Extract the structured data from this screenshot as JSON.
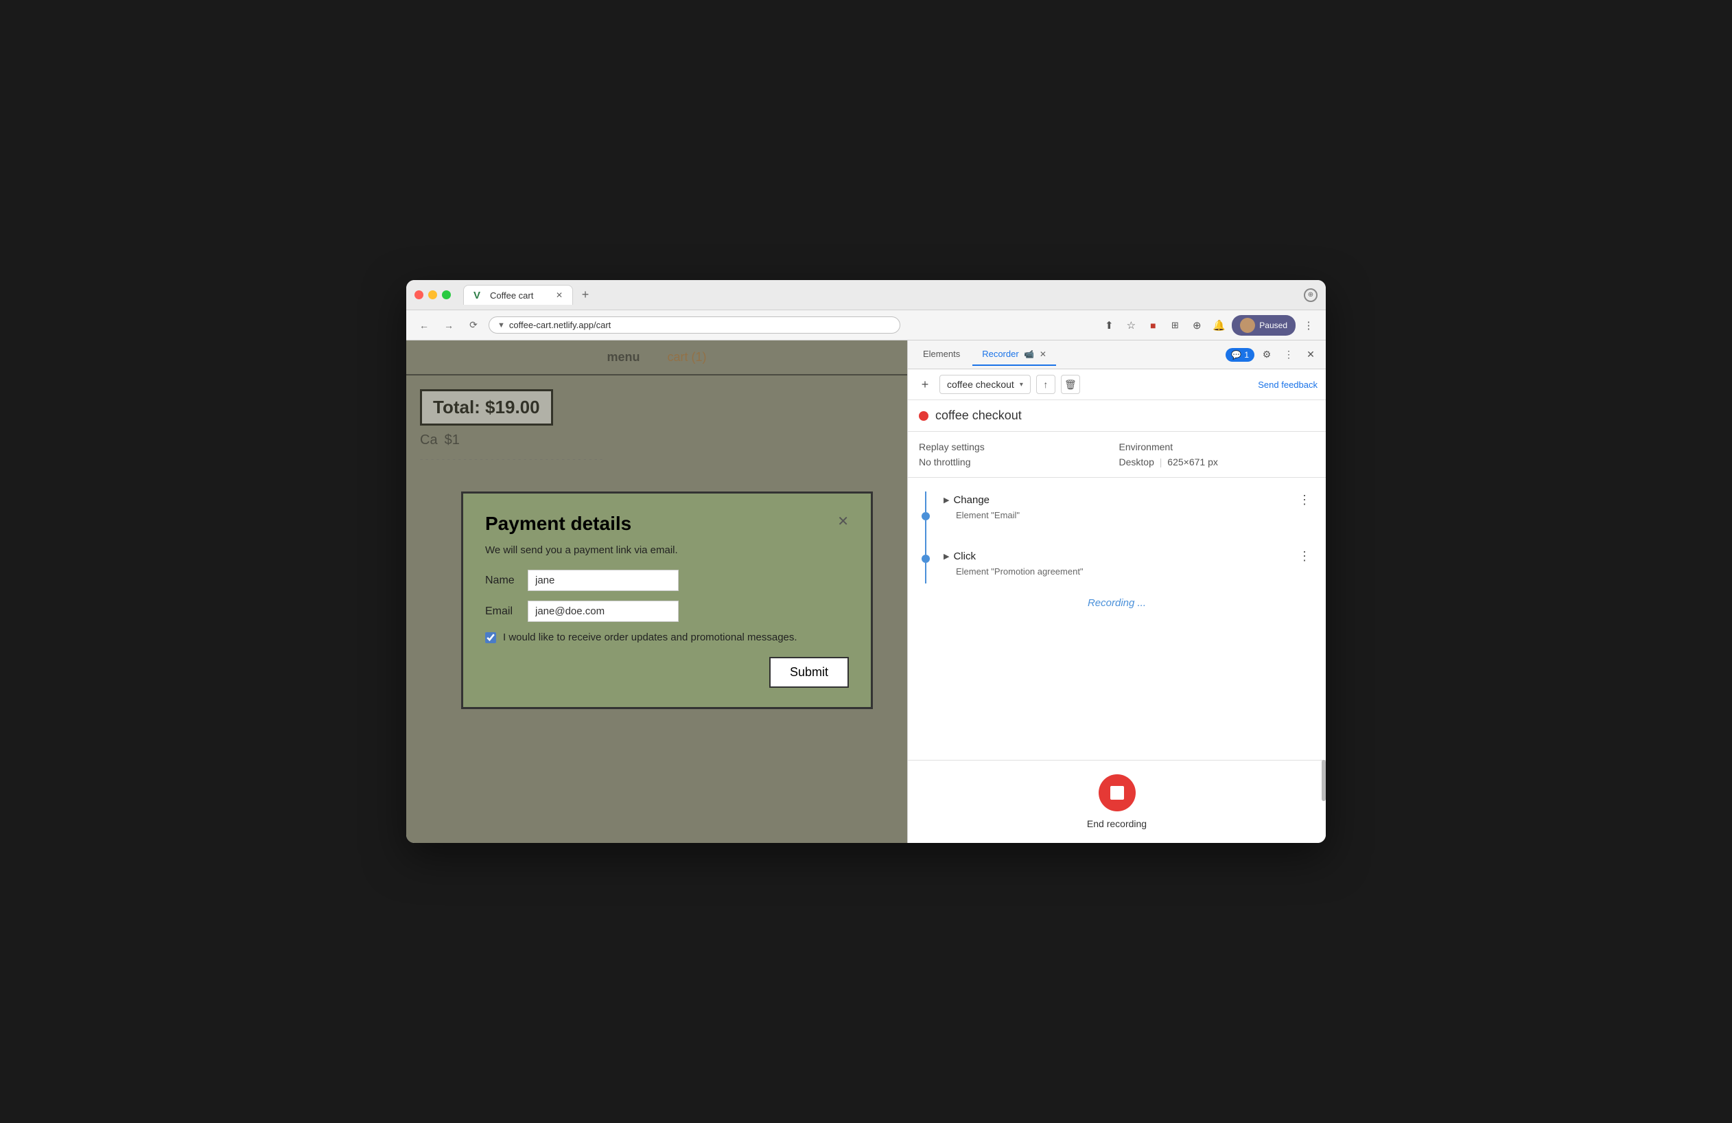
{
  "window": {
    "title": "Coffee cart"
  },
  "browser": {
    "tab_title": "Coffee cart",
    "tab_favicon": "V",
    "url": "coffee-cart.netlify.app/cart",
    "paused_label": "Paused"
  },
  "website": {
    "nav_menu": "menu",
    "nav_cart": "cart (1)",
    "total_label": "Total: $19.00",
    "cart_item_label": "Ca",
    "cart_item_price": "$1",
    "dashes": "- - - - - - - - - - - - - - - - - - -"
  },
  "modal": {
    "title": "Payment details",
    "subtitle": "We will send you a payment link via email.",
    "name_label": "Name",
    "name_value": "jane",
    "email_label": "Email",
    "email_value": "jane@doe.com",
    "checkbox_label": "I would like to receive order updates and promotional messages.",
    "submit_label": "Submit"
  },
  "devtools": {
    "tab_elements": "Elements",
    "tab_recorder": "Recorder",
    "tab_recorder_badge": "1",
    "more_tabs_label": "»",
    "settings_label": "⚙",
    "close_label": "✕",
    "more_label": "⋮",
    "feedback_label": "Send feedback",
    "add_label": "+",
    "dropdown_value": "coffee checkout",
    "dropdown_arrow": "▾",
    "upload_icon": "↑",
    "delete_icon": "🗑"
  },
  "recording": {
    "dot_color": "#e53935",
    "name": "coffee checkout",
    "replay_settings_label": "Replay settings",
    "environment_label": "Environment",
    "no_throttling": "No throttling",
    "desktop": "Desktop",
    "resolution": "625×671 px",
    "step1_type": "Change",
    "step1_detail": "Element \"Email\"",
    "step2_type": "Click",
    "step2_detail": "Element \"Promotion agreement\"",
    "status": "Recording ...",
    "end_label": "End recording"
  }
}
